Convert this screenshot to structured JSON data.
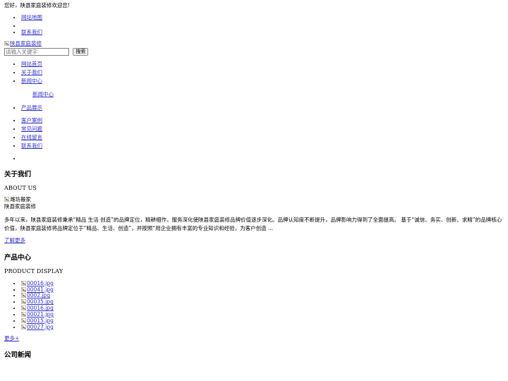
{
  "greeting": "您好，陕县家庭装修欢迎您!",
  "top_nav": [
    {
      "label": "网站地图"
    },
    {
      "label": ""
    },
    {
      "label": "联系我们"
    }
  ],
  "logo": {
    "alt": "陕县家庭装修",
    "icon": "broken-image-icon"
  },
  "search": {
    "placeholder": "请输入关键字",
    "value": "",
    "button_label": "搜索"
  },
  "main_nav": [
    {
      "label": "网站首页"
    },
    {
      "label": "关于我们"
    },
    {
      "label": "新闻中心"
    },
    {
      "label": "产品展示"
    },
    {
      "label": "客户案例"
    },
    {
      "label": "常见问题"
    },
    {
      "label": "在线留言"
    },
    {
      "label": "联系我们"
    }
  ],
  "submenu": [
    {
      "label": "新闻中心"
    }
  ],
  "about": {
    "title": "关于我们",
    "subtitle": "ABOUT US",
    "image_alt": "潍坊搬家",
    "image_icon": "broken-image-icon",
    "caption": "陕县家庭装修",
    "body": "多年以来，陕县家庭装修秉承“精品 生活 创造”的品牌定位，精耕细作，服务深化使陕县家庭装修品牌价值逐步深化。品牌认知度不断提升，品牌影响力得到了全面提高。 基于“诚信、务实、创新、求精”的品牌核心价值，陕县家庭装修将品牌定位于“精品、生活、创造”，并按照“用企业拥有丰富的专业知识和经验，为客户创造 ...",
    "more_label": "了解更多"
  },
  "products": {
    "title": "产品中心",
    "subtitle": "PRODUCT DISPLAY",
    "items": [
      {
        "alt": "00016.jpg",
        "icon": "broken-image-icon"
      },
      {
        "alt": "00041.jpg",
        "icon": "broken-image-icon"
      },
      {
        "alt": "0002.jpg",
        "icon": "broken-image-icon"
      },
      {
        "alt": "00035.jpg",
        "icon": "broken-image-icon"
      },
      {
        "alt": "00016.jpg",
        "icon": "broken-image-icon"
      },
      {
        "alt": "00021.jpg",
        "icon": "broken-image-icon"
      },
      {
        "alt": "00015.jpg",
        "icon": "broken-image-icon"
      },
      {
        "alt": "00027.jpg",
        "icon": "broken-image-icon"
      }
    ],
    "more_label": "更多+"
  },
  "news": {
    "title": "公司新闻"
  },
  "colors": {
    "link": "#3333CC",
    "text": "#000000",
    "background": "#FFFFFF",
    "input_border": "#808080",
    "button_face": "#EFEFEF"
  }
}
